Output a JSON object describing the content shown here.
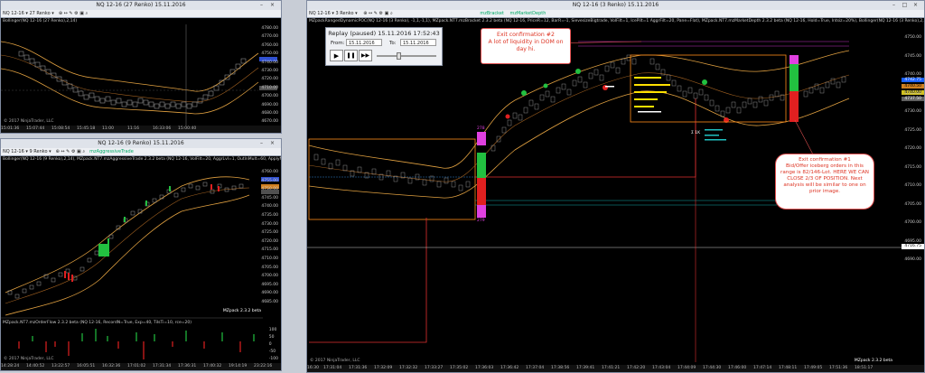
{
  "win_bollinger": {
    "title": "NQ 12-16 (27 Renko)  15.11.2016",
    "toolbar": "NQ 12-16  ▾  27 Renko ▾",
    "info": "Bollinger(NQ 12-16 (27 Renko),2,14)",
    "copyright": "© 2017 NinjaTrader, LLC",
    "prices": [
      "4780.00",
      "4770.00",
      "4760.00",
      "4750.00",
      "4740.00",
      "4730.00",
      "4720.00",
      "4710.00",
      "4700.00",
      "4690.00",
      "4680.00",
      "4670.00"
    ],
    "times": [
      "15:01:36",
      "15:07:44",
      "15:08:54",
      "15:45:18",
      "11:00",
      "11:16",
      "16:33:06",
      "15:00:40"
    ]
  },
  "win_9renko": {
    "title": "NQ 12-16 (9 Renko)  15.11.2016",
    "toolbar": "NQ 12-16  ▾  9 Renko ▾",
    "info": "Bollinger(NQ 12-16 (9 Renko),2,14), MZpack.NT7.mzAggressiveTrade 2.3.2 beta (NQ 12-16, VolFilt=20, AggrLvl=1, OutlnMult=60, ApplyMultF=False)",
    "mzpack_label": "MZpack 2.3.2 beta",
    "orderflow_info": "MZpack.NT7.mzOrderFlow 2.3.2 beta (NQ 12-16, RecordN=True, Exp=40, TilsTi=10, rce=20)",
    "copyright": "© 2017 NinjaTrader, LLC",
    "prices": [
      "4760.00",
      "4755.00",
      "4750.00",
      "4745.00",
      "4740.00",
      "4735.00",
      "4730.00",
      "4725.00",
      "4720.00",
      "4715.00",
      "4710.00",
      "4705.00",
      "4700.00",
      "4695.00",
      "4690.00",
      "4685.00"
    ],
    "of_scale": [
      "100",
      "50",
      "0",
      "-50",
      "-100"
    ],
    "times": [
      "14:28:24",
      "14:40:52",
      "13:22:57",
      "16:05:51",
      "16:32:36",
      "17:01:02",
      "17:31:34",
      "17:36:31",
      "17:40:32",
      "19:14:19",
      "23:22:16"
    ]
  },
  "win_main": {
    "title": "NQ 12-16 (3 Renko)  15.11.2016",
    "toolbar": "NQ 12-16  ▾  3 Renko ▾",
    "tabs": [
      "mzBracket",
      "mzMarketDepth"
    ],
    "info": "MZpackRangedDynamicPOC(NQ 12-16 (3 Renko), -1,1,-1,1), MZpack.NT7.mzBracket 2.3.2 beta (NQ 12-16, PriceR=12, BarR=-1, SievesizeBigtrade, VolFilt=1, IcePilt=1 AggrFilt=20, Pane=Flat), MZpack.NT7.mzMarketDepth 2.3.2 beta (NQ 12-16, Hold=True, Intsiz=20%), Bollinger(NQ 12-16 (3 Renko),2,14)",
    "copyright": "© 2017 NinjaTrader, LLC",
    "mzpack_label": "MZpack 2.3.2 beta",
    "sigma_label": "Σ 1K",
    "price_labels": [
      "4750.00",
      "4745.00",
      "4740.00",
      "4735.00",
      "4730.00",
      "4725.00",
      "4720.00",
      "4715.00",
      "4710.00",
      "4705.00",
      "4700.00",
      "4695.00",
      "4690.00"
    ],
    "current_price": "4716.75",
    "badge_prices": [
      "4742.75",
      "4740.50",
      "4740.00",
      "4737.50"
    ],
    "times": [
      "16:30",
      "17:31:04",
      "17:31:36",
      "17:32:09",
      "17:32:32",
      "17:33:27",
      "17:35:02",
      "17:36:03",
      "17:36:42",
      "17:37:04",
      "17:38:56",
      "17:39:41",
      "17:41:21",
      "17:42:20",
      "17:43:04",
      "17:44:09",
      "17:44:30",
      "17:46:00",
      "17:47:14",
      "17:48:11",
      "17:49:05",
      "17:51:36",
      "18:51:17"
    ],
    "block_labels": [
      "278",
      "279"
    ]
  },
  "replay": {
    "title": "Replay (paused) 15.11.2016 17:52:43",
    "from_label": "From:",
    "from_value": "15.11.2016",
    "to_label": "To:",
    "to_value": "15.11.2016",
    "play_icon": "▶",
    "pause_icon": "❚❚",
    "forward_icon": "▶▶"
  },
  "callout_2": {
    "text": "Exit confirmation #2\nA lot of liquidity in DOM on day hi."
  },
  "callout_1": {
    "text": "Exit confirmation #1\nBid/Offer iceberg orders in this range is 82/146-Lot. HERE WE CAN CLOSE 2/3 OF POSITION. Next analysis will be similar to one on prior image."
  },
  "colors": {
    "background": "#000000",
    "bull": "#22c040",
    "bear": "#e02020",
    "band": "#e0a040",
    "accent_orange": "#ff8c1a",
    "magenta": "#e040e0"
  }
}
